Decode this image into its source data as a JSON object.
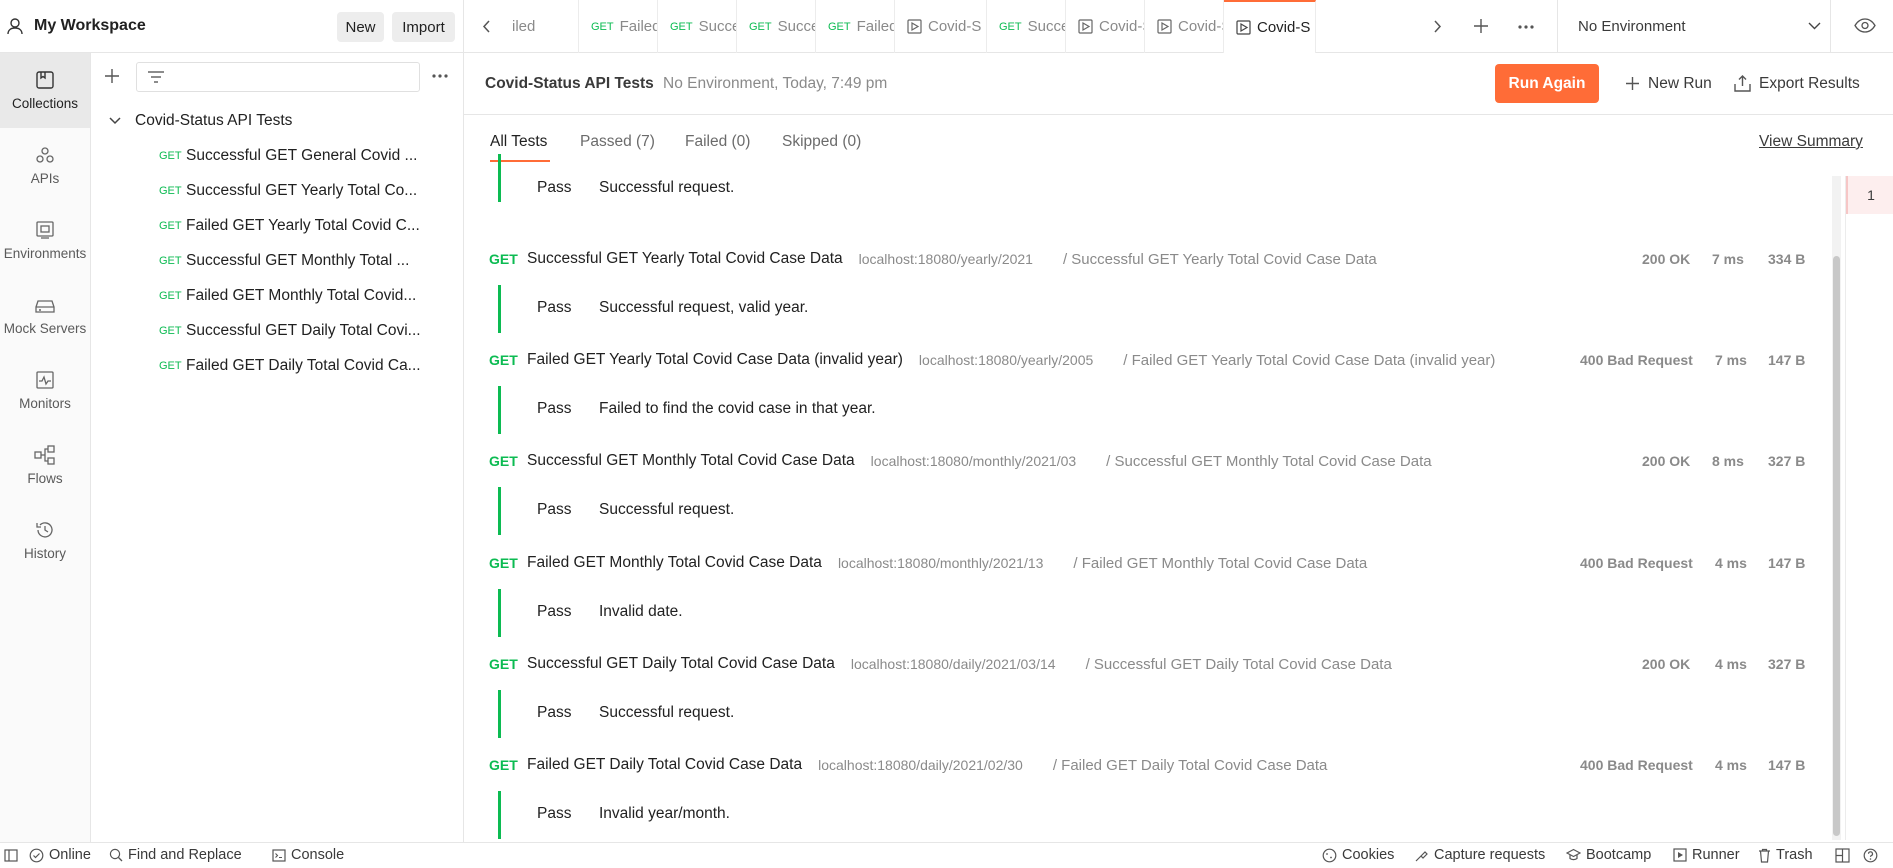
{
  "workspace": {
    "title": "My Workspace",
    "new_label": "New",
    "import_label": "Import"
  },
  "rail": [
    {
      "label": "Collections",
      "icon": "collections-icon",
      "active": true
    },
    {
      "label": "APIs",
      "icon": "apis-icon"
    },
    {
      "label": "Environments",
      "icon": "environments-icon"
    },
    {
      "label": "Mock Servers",
      "icon": "mock-servers-icon"
    },
    {
      "label": "Monitors",
      "icon": "monitors-icon"
    },
    {
      "label": "Flows",
      "icon": "flows-icon"
    },
    {
      "label": "History",
      "icon": "history-icon"
    }
  ],
  "collection": {
    "name": "Covid-Status API Tests",
    "requests": [
      {
        "method": "GET",
        "name": "Successful GET General Covid ..."
      },
      {
        "method": "GET",
        "name": "Successful GET Yearly Total Co..."
      },
      {
        "method": "GET",
        "name": "Failed GET Yearly Total Covid C..."
      },
      {
        "method": "GET",
        "name": "Successful GET Monthly Total ..."
      },
      {
        "method": "GET",
        "name": "Failed GET Monthly Total Covid..."
      },
      {
        "method": "GET",
        "name": "Successful GET Daily Total Covi..."
      },
      {
        "method": "GET",
        "name": "Failed GET Daily Total Covid Ca..."
      }
    ]
  },
  "tabs": [
    {
      "method": "",
      "label": "iled"
    },
    {
      "method": "GET",
      "label": "Failed"
    },
    {
      "method": "GET",
      "label": "Succes"
    },
    {
      "method": "GET",
      "label": "Succes"
    },
    {
      "method": "GET",
      "label": "Failed"
    },
    {
      "method": "",
      "label": "Covid-S"
    },
    {
      "method": "GET",
      "label": "Succes"
    },
    {
      "method": "",
      "label": "Covid-S"
    },
    {
      "method": "",
      "label": "Covid-S"
    },
    {
      "method": "",
      "label": "Covid-S"
    }
  ],
  "environment": {
    "selected": "No Environment"
  },
  "run": {
    "title": "Covid-Status API Tests",
    "subtitle": "No Environment, Today, 7:49 pm",
    "run_again": "Run Again",
    "new_run": "New Run",
    "export": "Export Results"
  },
  "filters": {
    "all": "All Tests",
    "passed": "Passed (7)",
    "failed": "Failed (0)",
    "skipped": "Skipped (0)",
    "view_summary": "View Summary"
  },
  "first_result": {
    "status": "Pass",
    "message": "Successful request."
  },
  "results": [
    {
      "method": "GET",
      "name": "Successful GET Yearly Total Covid Case Data",
      "url": "localhost:18080/yearly/2021",
      "path": "/ Successful GET Yearly Total Covid Case Data",
      "code": "200 OK",
      "time": "7 ms",
      "size": "334 B",
      "status": "Pass",
      "message": "Successful request, valid year."
    },
    {
      "method": "GET",
      "name": "Failed GET Yearly Total Covid Case Data (invalid year)",
      "url": "localhost:18080/yearly/2005",
      "path": "/ Failed GET Yearly Total Covid Case Data (invalid year)",
      "code": "400 Bad Request",
      "time": "7 ms",
      "size": "147 B",
      "status": "Pass",
      "message": "Failed to find the covid case in that year."
    },
    {
      "method": "GET",
      "name": "Successful GET Monthly Total Covid Case Data",
      "url": "localhost:18080/monthly/2021/03",
      "path": "/ Successful GET Monthly Total Covid Case Data",
      "code": "200 OK",
      "time": "8 ms",
      "size": "327 B",
      "status": "Pass",
      "message": "Successful request."
    },
    {
      "method": "GET",
      "name": "Failed GET Monthly Total Covid Case Data",
      "url": "localhost:18080/monthly/2021/13",
      "path": "/ Failed GET Monthly Total Covid Case Data",
      "code": "400 Bad Request",
      "time": "4 ms",
      "size": "147 B",
      "status": "Pass",
      "message": "Invalid date."
    },
    {
      "method": "GET",
      "name": "Successful GET Daily Total Covid Case Data",
      "url": "localhost:18080/daily/2021/03/14",
      "path": "/ Successful GET Daily Total Covid Case Data",
      "code": "200 OK",
      "time": "4 ms",
      "size": "327 B",
      "status": "Pass",
      "message": "Successful request."
    },
    {
      "method": "GET",
      "name": "Failed GET Daily Total Covid Case Data",
      "url": "localhost:18080/daily/2021/02/30",
      "path": "/ Failed GET Daily Total Covid Case Data",
      "code": "400 Bad Request",
      "time": "4 ms",
      "size": "147 B",
      "status": "Pass",
      "message": "Invalid year/month."
    }
  ],
  "iteration": {
    "number": "1"
  },
  "footer": {
    "online": "Online",
    "find_replace": "Find and Replace",
    "console": "Console",
    "cookies": "Cookies",
    "capture": "Capture requests",
    "bootcamp": "Bootcamp",
    "runner": "Runner",
    "trash": "Trash"
  },
  "colors": {
    "accent": "#ff6c37",
    "get": "#0cbb52",
    "muted": "#8a8a8a"
  }
}
